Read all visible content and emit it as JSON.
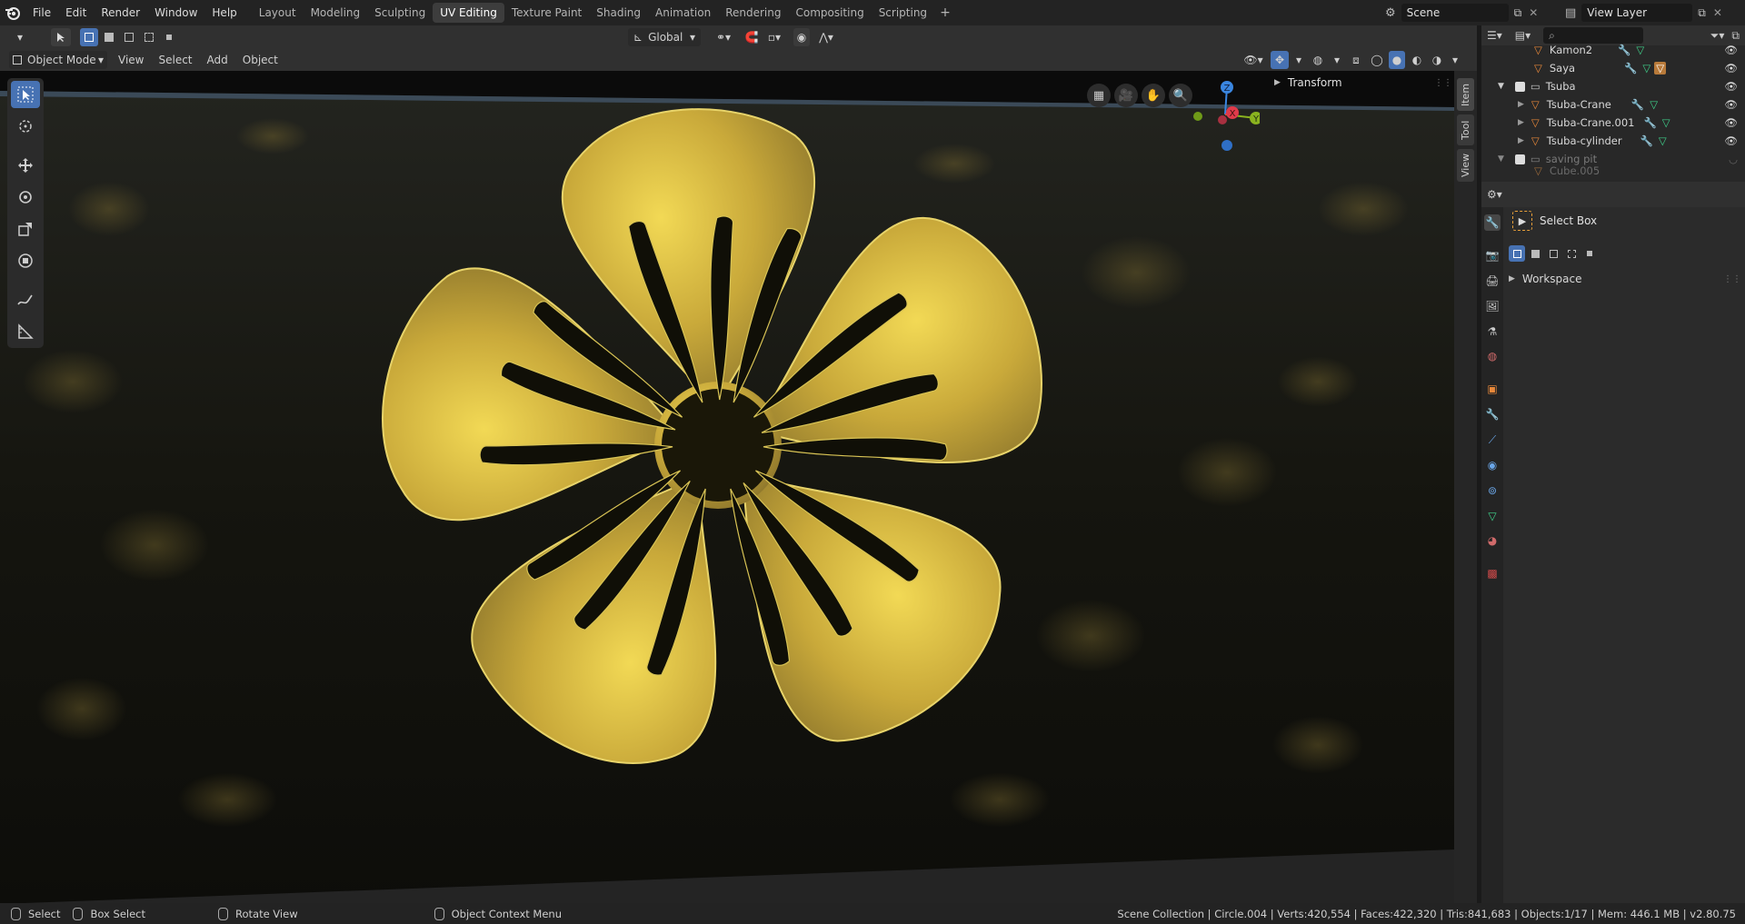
{
  "topbar": {
    "menus": [
      "File",
      "Edit",
      "Render",
      "Window",
      "Help"
    ],
    "workspaces": [
      "Layout",
      "Modeling",
      "Sculpting",
      "UV Editing",
      "Texture Paint",
      "Shading",
      "Animation",
      "Rendering",
      "Compositing",
      "Scripting"
    ],
    "active_workspace": "UV Editing",
    "add_workspace": "+",
    "scene": "Scene",
    "view_layer": "View Layer"
  },
  "header": {
    "orientation": "Global"
  },
  "viewport_header": {
    "mode": "Object Mode",
    "menus": [
      "View",
      "Select",
      "Add",
      "Object"
    ]
  },
  "gizmo": {
    "x": "X",
    "y": "Y",
    "z": "Z"
  },
  "sidebar_tabs": [
    "Item",
    "Tool",
    "View"
  ],
  "n_panel": {
    "transform": "Transform"
  },
  "outliner": {
    "rows": [
      {
        "name": "Kamon2"
      },
      {
        "name": "Saya"
      },
      {
        "name": "Tsuba"
      },
      {
        "name": "Tsuba-Crane"
      },
      {
        "name": "Tsuba-Crane.001"
      },
      {
        "name": "Tsuba-cylinder"
      },
      {
        "name": "saving pit"
      },
      {
        "name": "Cube.005"
      }
    ]
  },
  "properties": {
    "tool_name": "Select Box",
    "workspace": "Workspace"
  },
  "statusbar": {
    "select": "Select",
    "box_select": "Box Select",
    "rotate": "Rotate View",
    "context_menu": "Object Context Menu",
    "stats": "Scene Collection | Circle.004 | Verts:420,554 | Faces:422,320 | Tris:841,683 | Objects:1/17 | Mem: 446.1 MB | v2.80.75"
  },
  "colors": {
    "accent": "#4772b3",
    "gold": "#c9b23c",
    "x_axis": "#e03a4a",
    "y_axis": "#8ab21f",
    "z_axis": "#3a86e0"
  }
}
